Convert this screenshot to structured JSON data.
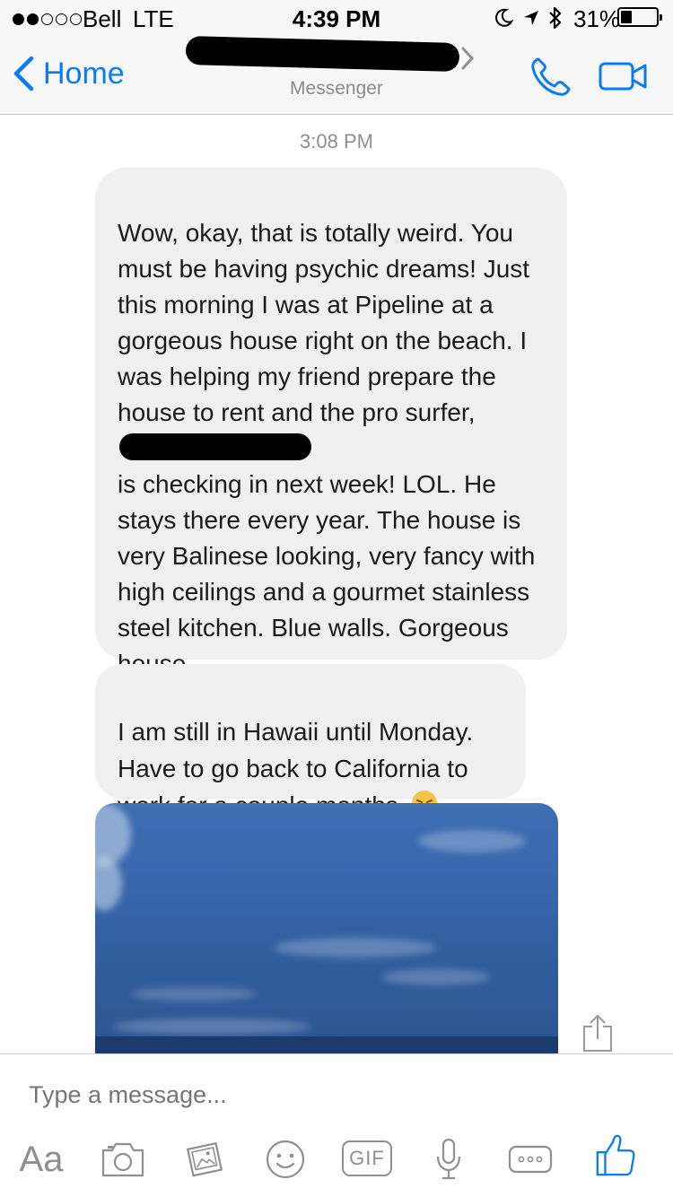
{
  "status_bar": {
    "carrier": "Bell",
    "network": "LTE",
    "time": "4:39 PM",
    "battery_percent": "31%",
    "battery_level": 0.31,
    "signal_bars_filled": 2,
    "signal_bars_total": 5
  },
  "nav": {
    "back_label": "Home",
    "subtitle": "Messenger",
    "accent_color": "#0a7cf0"
  },
  "chat": {
    "timestamp": "3:08 PM",
    "message1": {
      "before_redaction": "Wow, okay, that is totally weird. You must be having psychic dreams! Just this morning I was at Pipeline at a gorgeous house right on the beach. I was helping my friend prepare the house to rent and the pro surfer, ",
      "after_redaction": "\nis checking in next week! LOL. He stays there every year. The house is very Balinese looking, very fancy with high ceilings and a gourmet stainless steel kitchen. Blue walls. Gorgeous house."
    },
    "message2": {
      "text": "I am still in Hawaii until Monday. Have to go back to California to work for a couple months.",
      "emoji": "disappointed-face"
    },
    "photo": {
      "subject": "ocean-sky-photo"
    }
  },
  "composer": {
    "placeholder": "Type a message...",
    "aa_label": "Aa",
    "gif_label": "GIF",
    "tools": [
      "text-format",
      "camera",
      "photo-gallery",
      "emoji",
      "gif",
      "microphone",
      "more",
      "like"
    ]
  }
}
